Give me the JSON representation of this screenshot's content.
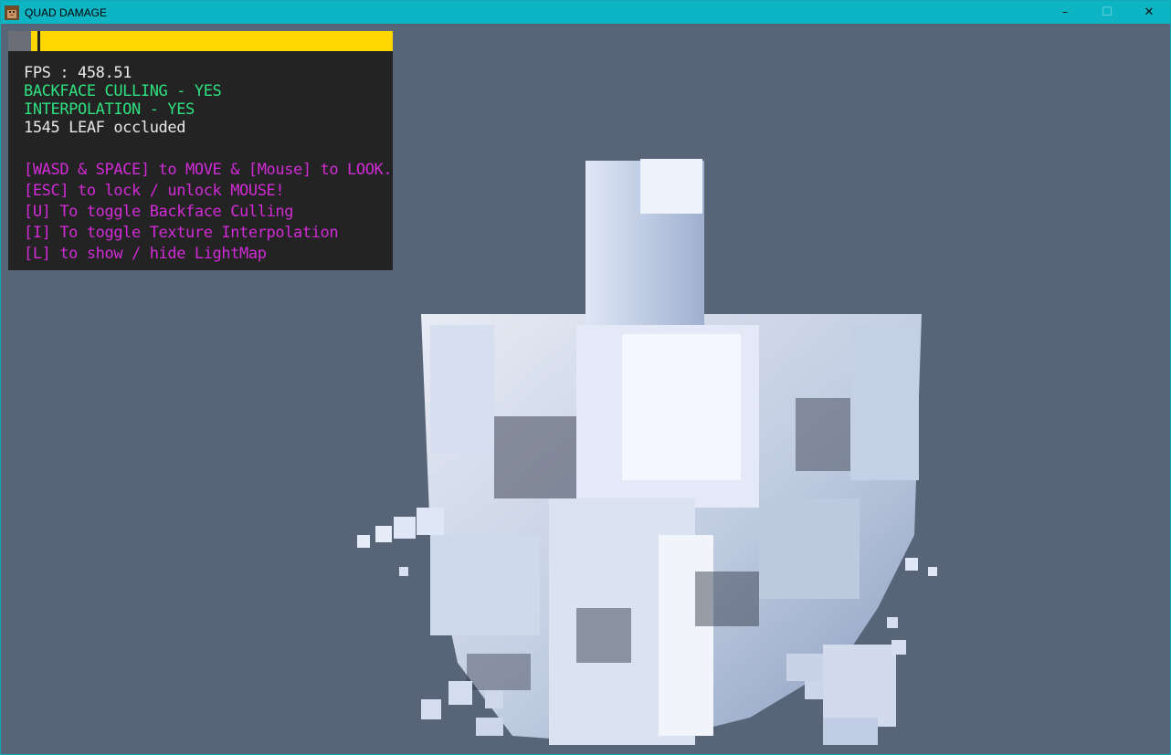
{
  "window": {
    "title": "QUAD DAMAGE",
    "controls": {
      "minimize": "–",
      "maximize": "☐",
      "close": "✕"
    }
  },
  "hud": {
    "fps_line": "FPS : 458.51",
    "backface_line": "BACKFACE CULLING - YES",
    "interpolation_line": "INTERPOLATION - YES",
    "occluded_line": "1545 LEAF occluded",
    "help": [
      "[WASD & SPACE] to MOVE & [Mouse] to LOOK.",
      "[ESC] to lock / unlock MOUSE!",
      "[U] To toggle Backface Culling",
      "[I] To toggle Texture Interpolation",
      "[L] to show / hide LightMap"
    ],
    "colors": {
      "status": "#e8e8e8",
      "enabled": "#2ee07f",
      "help": "#d12bd6",
      "bar": "#ffd700"
    }
  },
  "scene": {
    "subject": "voxel-cube-structure",
    "background": "#586578"
  }
}
